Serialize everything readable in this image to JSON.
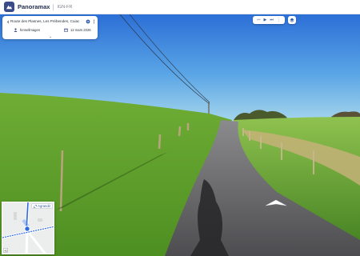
{
  "header": {
    "app_title": "Panoramax",
    "app_subtitle": "IGN-FR"
  },
  "info_card": {
    "address": "Route des Plasnes, Les Prébendes, Cuiac",
    "author": "fennellmagen",
    "date": "12 mars 2026"
  },
  "player": {
    "icons": [
      "skip-back-icon",
      "play-icon",
      "fast-forward-icon",
      "more-icon"
    ]
  },
  "minimap": {
    "enlarge_label": "Agrandir"
  },
  "colors": {
    "sky_top": "#2c6fd6",
    "sky_bottom": "#9ed2ec",
    "grass": "#5e9c2c",
    "road": "#5a5a5c",
    "accent": "#2d5aa8"
  }
}
